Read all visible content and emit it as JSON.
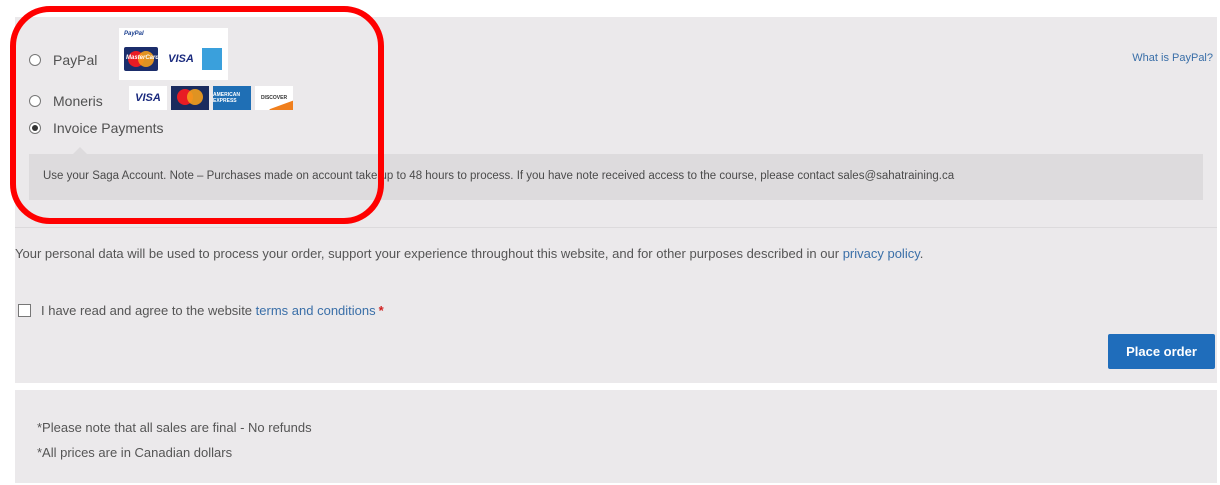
{
  "payment_methods": [
    {
      "label": "PayPal",
      "checked": false
    },
    {
      "label": "Moneris",
      "checked": false
    },
    {
      "label": "Invoice Payments",
      "checked": true
    }
  ],
  "paypal_logo_text": "PayPal",
  "card_logos": {
    "mastercard": "MasterCard",
    "visa": "VISA",
    "amex": "AMERICAN EXPRESS",
    "discover": "DISCOVER"
  },
  "what_is_paypal": "What is PayPal?",
  "invoice_notice": "Use your Saga Account. Note – Purchases made on account take up to 48 hours to process. If you have note received access to the course, please contact sales@sahatraining.ca",
  "privacy": {
    "text": "Your personal data will be used to process your order, support your experience throughout this website, and for other purposes described in our ",
    "link": "privacy policy",
    "end": "."
  },
  "terms": {
    "text": "I have read and agree to the website ",
    "link": "terms and conditions",
    "required": "*"
  },
  "place_order": "Place order",
  "notes": [
    "*Please note that all sales are final - No refunds",
    "*All prices are in Canadian dollars"
  ],
  "colors": {
    "accent": "#1f6dbb",
    "highlight": "#ff0000",
    "link": "#3a6fa8"
  }
}
